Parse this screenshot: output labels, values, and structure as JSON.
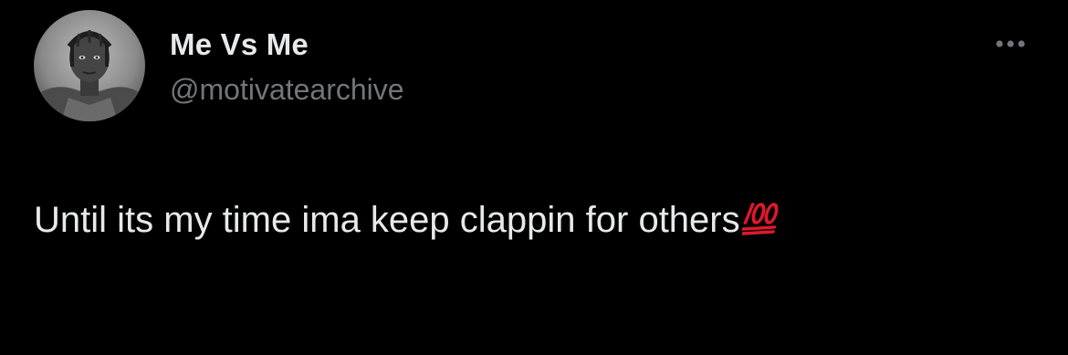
{
  "author": {
    "display_name": "Me Vs Me",
    "handle": "@motivatearchive",
    "avatar_icon": "profile-photo"
  },
  "post": {
    "text": "Until its my time ima keep clappin for others",
    "emoji_icon": "hundred-points-icon"
  },
  "menu": {
    "icon": "more-horizontal-icon"
  },
  "colors": {
    "background": "#000000",
    "primary_text": "#e7e9ea",
    "secondary_text": "#71767b",
    "emoji_red": "#e0182d"
  }
}
